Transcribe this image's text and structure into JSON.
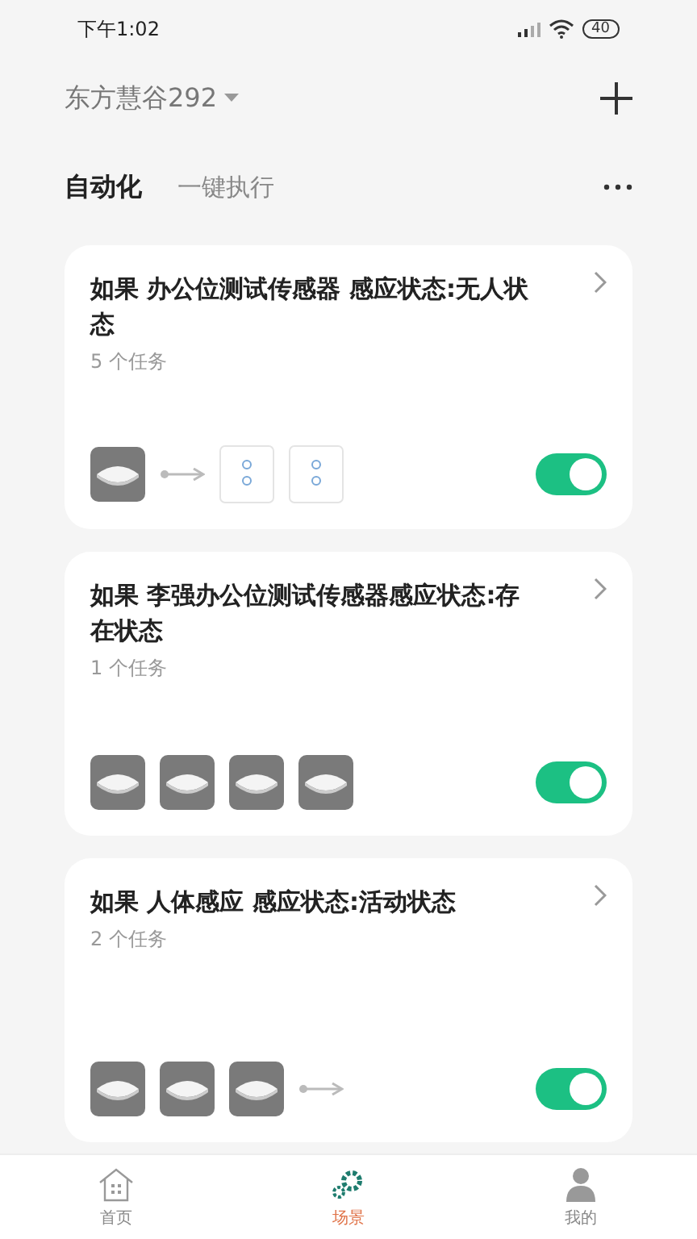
{
  "status_bar": {
    "time": "下午1:02",
    "battery": "40"
  },
  "header": {
    "home": "东方慧谷292"
  },
  "tabs": [
    {
      "label": "自动化",
      "selected": true
    },
    {
      "label": "一键执行",
      "selected": false
    }
  ],
  "cards": [
    {
      "title": "如果 办公位测试传感器 感应状态:无人状态",
      "tasks": "5 个任务",
      "on": true,
      "devices": [
        {
          "kind": "sensor"
        },
        {
          "kind": "arrow"
        },
        {
          "kind": "panel"
        },
        {
          "kind": "panel"
        }
      ]
    },
    {
      "title": "如果 李强办公位测试传感器感应状态:存在状态",
      "tasks": "1 个任务",
      "on": true,
      "devices": [
        {
          "kind": "sensor"
        },
        {
          "kind": "sensor"
        },
        {
          "kind": "sensor"
        },
        {
          "kind": "sensor"
        }
      ]
    },
    {
      "title": "如果 人体感应 感应状态:活动状态",
      "tasks": "2 个任务",
      "on": true,
      "devices": [
        {
          "kind": "sensor"
        },
        {
          "kind": "sensor"
        },
        {
          "kind": "sensor"
        },
        {
          "kind": "arrow"
        }
      ]
    }
  ],
  "nav": [
    {
      "label": "首页",
      "kind": "home",
      "selected": false
    },
    {
      "label": "场景",
      "kind": "scene",
      "selected": true
    },
    {
      "label": "我的",
      "kind": "me",
      "selected": false
    }
  ]
}
